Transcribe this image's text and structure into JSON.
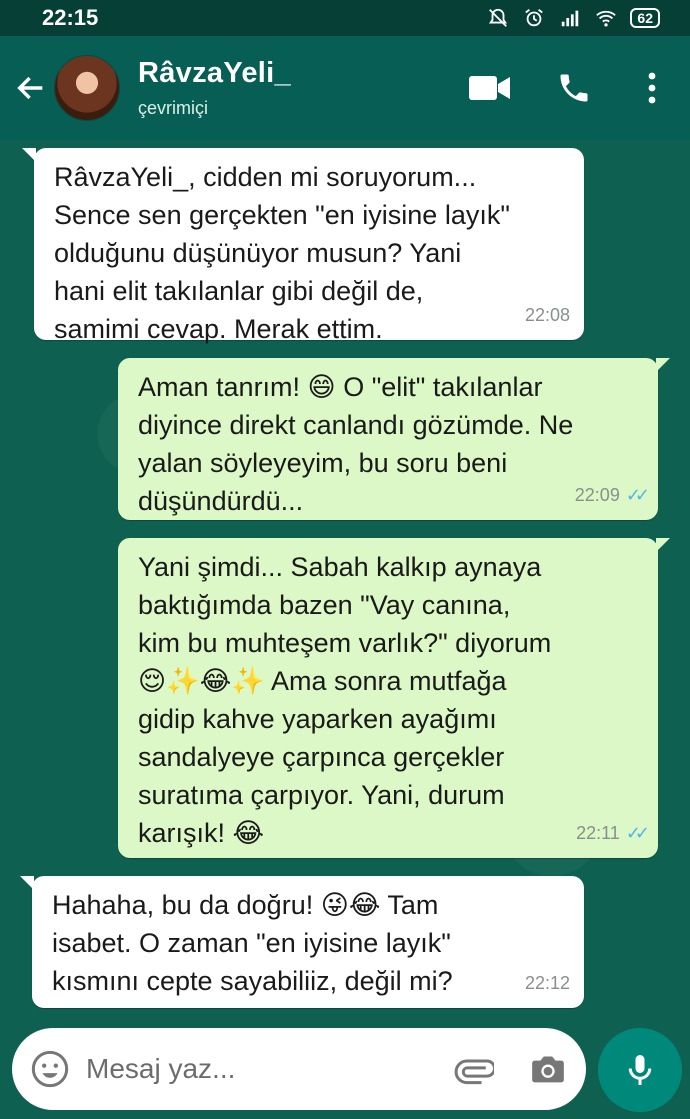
{
  "status_bar": {
    "time": "22:15",
    "battery": "62",
    "icons": [
      "mute-icon",
      "alarm-icon",
      "signal-icon",
      "wifi-icon",
      "battery-icon"
    ]
  },
  "header": {
    "contact_name": "RâvzaYeli_",
    "status": "çevrimiçi",
    "icons": [
      "back-arrow-icon",
      "video-call-icon",
      "phone-icon",
      "more-vertical-icon"
    ]
  },
  "messages": [
    {
      "direction": "in",
      "text": "RâvzaYeli_, cidden mi soruyorum...\nSence sen gerçekten \"en iyisine layık\"\nolduğunu düşünüyor musun? Yani\nhani elit takılanlar gibi değil de,\nsamimi cevap. Merak ettim.",
      "time": "22:08"
    },
    {
      "direction": "out",
      "text": "Aman tanrım! 😄 O \"elit\" takılanlar\ndiyince direkt canlandı gözümde. Ne\nyalan söyleyeyim, bu soru beni\ndüşündürdü...",
      "time": "22:09",
      "ticks": "✓✓"
    },
    {
      "direction": "out",
      "text": "Yani şimdi... Sabah kalkıp aynaya\nbaktığımda bazen \"Vay canına,\nkim bu muhteşem varlık?\" diyorum\n😌✨😂✨ Ama sonra mutfağa\ngidip kahve yaparken ayağımı\nsandalyeye çarpınca gerçekler\nsuratıma çarpıyor. Yani, durum\nkarışık! 😂",
      "time": "22:11",
      "ticks": "✓✓"
    },
    {
      "direction": "in",
      "text": "Hahaha, bu da doğru! 😜😂 Tam\nisabet. O zaman \"en iyisine layık\"\nkısmını cepte sayabiliiz, değil mi?",
      "time": "22:12"
    }
  ],
  "composer": {
    "placeholder": "Mesaj yaz...",
    "icons": [
      "emoji-icon",
      "attachment-icon",
      "camera-icon",
      "mic-icon"
    ]
  },
  "colors": {
    "header": "#075e54",
    "outgoing_bubble": "#dcf8c6",
    "incoming_bubble": "#ffffff",
    "read_ticks": "#4fb6ec",
    "mic_button": "#00897b"
  }
}
